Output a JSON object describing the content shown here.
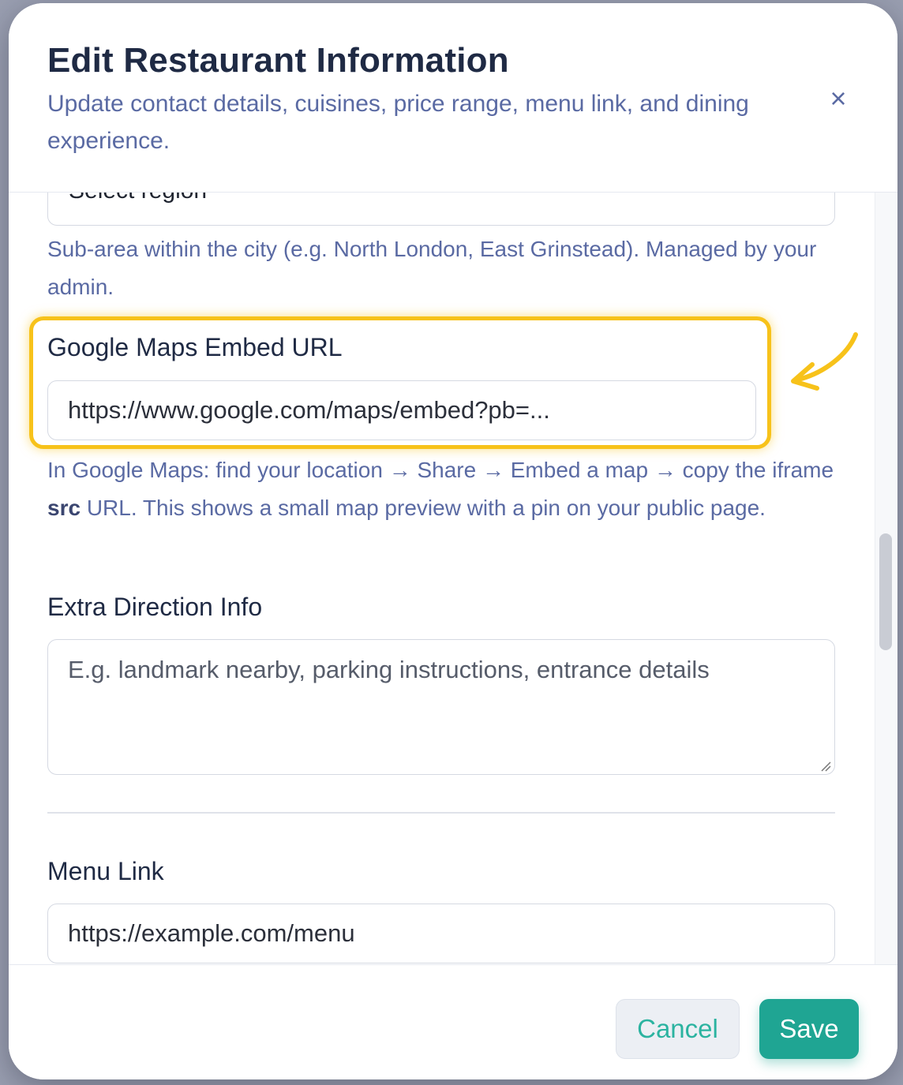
{
  "modal": {
    "title": "Edit Restaurant Information",
    "subtitle": "Update contact details, cuisines, price range, menu link, and dining experience.",
    "close_icon": "×"
  },
  "region": {
    "value": "Select region",
    "help": "Sub-area within the city (e.g. North London, East Grinstead). Managed by your admin."
  },
  "maps": {
    "label": "Google Maps Embed URL",
    "placeholder": "https://www.google.com/maps/embed?pb=...",
    "help_before": "In Google Maps: find your location → Share → Embed a map → copy the iframe ",
    "help_bold": "src",
    "help_after": " URL. This shows a small map preview with a pin on your public page."
  },
  "directions": {
    "label": "Extra Direction Info",
    "placeholder": "E.g. landmark nearby, parking instructions, entrance details"
  },
  "menu": {
    "label": "Menu Link",
    "placeholder": "https://example.com/menu"
  },
  "footer": {
    "cancel_label": "Cancel",
    "save_label": "Save"
  },
  "colors": {
    "accent": "#1fa593",
    "highlight": "#f7c21a",
    "help_text": "#5a6aa3"
  }
}
